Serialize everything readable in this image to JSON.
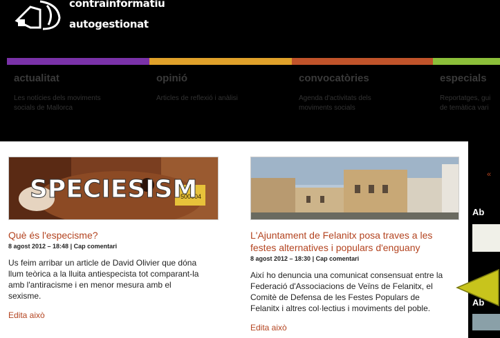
{
  "logo": {
    "line1": "contrainformatiu",
    "line2": "autogestionat",
    "icon": "megaphone-icon"
  },
  "nav": [
    {
      "title": "actualitat",
      "desc1": "Les notícies dels moviments",
      "desc2": "socials de Mallorca",
      "color": "#7a32a8"
    },
    {
      "title": "opinió",
      "desc1": "Articles de reflexió i anàlisi",
      "desc2": "",
      "color": "#e0a12a"
    },
    {
      "title": "convocatòries",
      "desc1": "Agenda d'activitats dels",
      "desc2": "moviments socials",
      "color": "#c0532a"
    },
    {
      "title": "especials",
      "desc1": "Reportatges, gui",
      "desc2": "de temàtica vari",
      "color": "#8cbf3a"
    }
  ],
  "posts": [
    {
      "image_text": "SPECIESISM",
      "title": "Què és l'especisme?",
      "date": "8 agost 2012 – 18:48",
      "comments": "Cap comentari",
      "body": [
        "Us feim arribar un article de David Olivier que dóna",
        "llum teòrica a la lluita antiespecista tot comparant-la",
        "amb l'antiracisme i en menor mesura amb el",
        "sexisme."
      ],
      "edit": "Edita això"
    },
    {
      "title_lines": [
        "L'Ajuntament de Felanitx posa traves a les",
        "festes alternatives i populars d'enguany"
      ],
      "date": "8 agost 2012 – 18:30",
      "comments": "Cap comentari",
      "body": [
        "Així ho denuncia una comunicat consensuat entre la",
        "Federació d'Associacions de Veïns de Felanitx, el",
        "Comitè de Defensa de les Festes Populars de",
        "Felanitx i altres col·lectius i moviments del poble."
      ],
      "edit": "Edita això"
    }
  ],
  "sidebar": {
    "link": "«",
    "head1": "Ab",
    "head2": "Ab"
  },
  "colors": {
    "link": "#b3431f",
    "background": "#000000",
    "content_bg": "#ffffff"
  }
}
